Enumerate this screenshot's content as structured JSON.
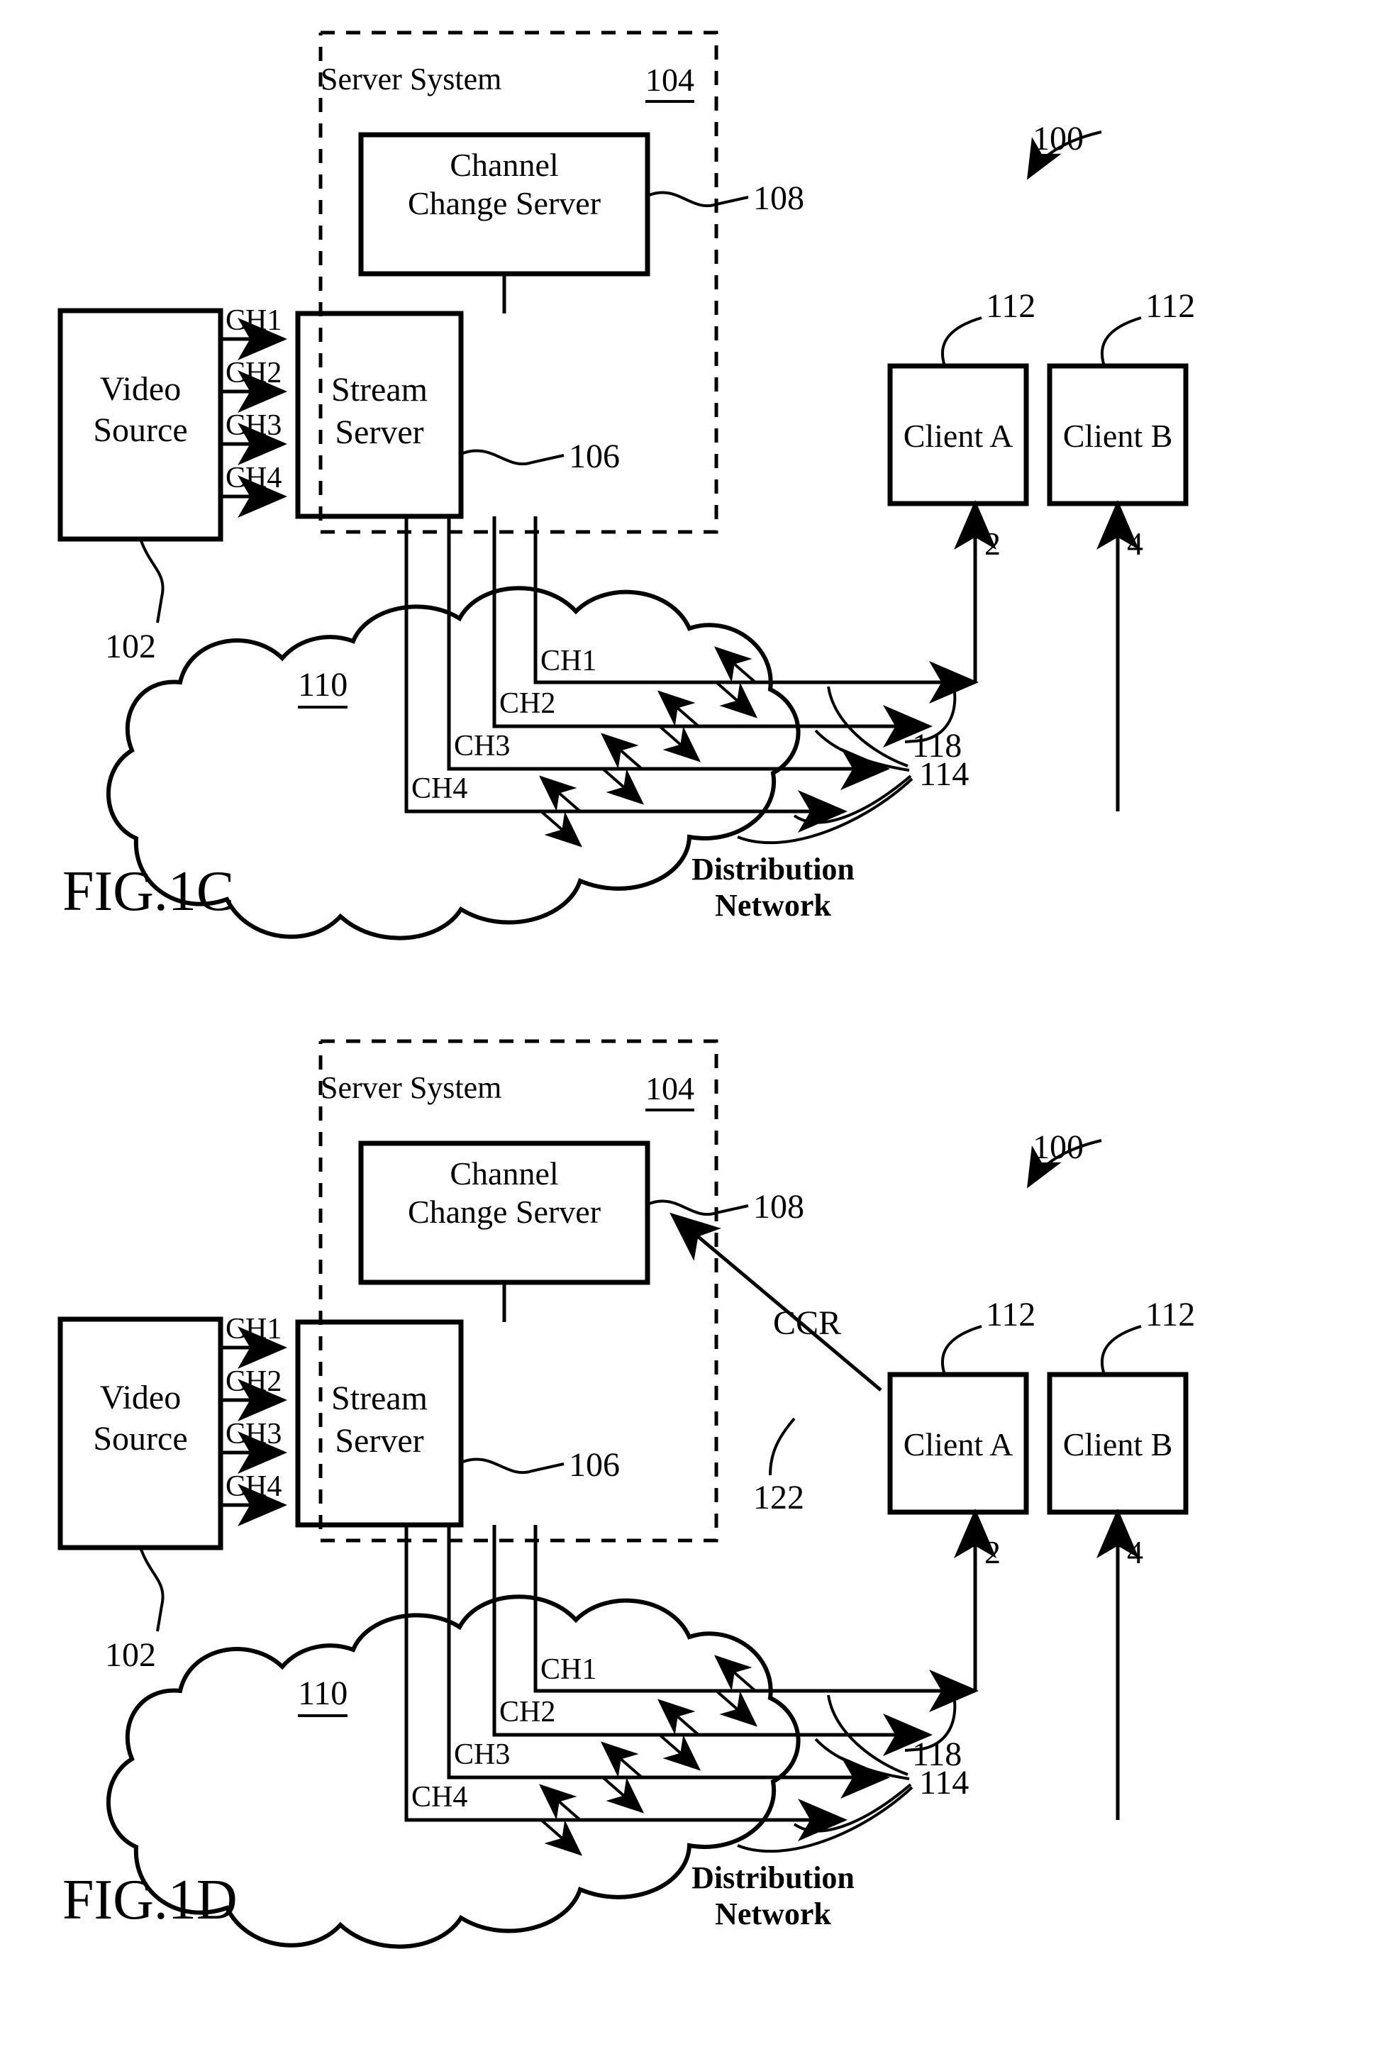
{
  "figures": [
    {
      "id": "fig1c",
      "caption": "FIG.1C",
      "system_ref": "100",
      "server_system": {
        "label": "Server System",
        "ref": "104",
        "channel_change_server": {
          "line1": "Channel",
          "line2": "Change Server",
          "ref": "108"
        },
        "stream_server": {
          "line1": "Stream",
          "line2": "Server",
          "ref": "106"
        }
      },
      "video_source": {
        "line1": "Video",
        "line2": "Source",
        "ref": "102"
      },
      "input_channels": [
        "CH1",
        "CH2",
        "CH3",
        "CH4"
      ],
      "network": {
        "label": "Distribution Network",
        "ref": "110",
        "channels": [
          "CH1",
          "CH2",
          "CH3",
          "CH4"
        ],
        "multicast_ref": "114",
        "stream_to_client_ref": "118"
      },
      "clients": [
        {
          "label": "Client A",
          "ref": "112",
          "link_number": "2"
        },
        {
          "label": "Client B",
          "ref": "112",
          "link_number": "4"
        }
      ]
    },
    {
      "id": "fig1d",
      "caption": "FIG.1D",
      "system_ref": "100",
      "server_system": {
        "label": "Server System",
        "ref": "104",
        "channel_change_server": {
          "line1": "Channel",
          "line2": "Change Server",
          "ref": "108"
        },
        "stream_server": {
          "line1": "Stream",
          "line2": "Server",
          "ref": "106"
        }
      },
      "video_source": {
        "line1": "Video",
        "line2": "Source",
        "ref": "102"
      },
      "input_channels": [
        "CH1",
        "CH2",
        "CH3",
        "CH4"
      ],
      "ccr": {
        "label": "CCR",
        "ref": "122"
      },
      "network": {
        "label": "Distribution Network",
        "ref": "110",
        "channels": [
          "CH1",
          "CH2",
          "CH3",
          "CH4"
        ],
        "multicast_ref": "114",
        "stream_to_client_ref": "118"
      },
      "clients": [
        {
          "label": "Client A",
          "ref": "112",
          "link_number": "2"
        },
        {
          "label": "Client B",
          "ref": "112",
          "link_number": "4"
        }
      ]
    }
  ],
  "colors": {
    "ink": "#000000",
    "paper": "#ffffff"
  }
}
